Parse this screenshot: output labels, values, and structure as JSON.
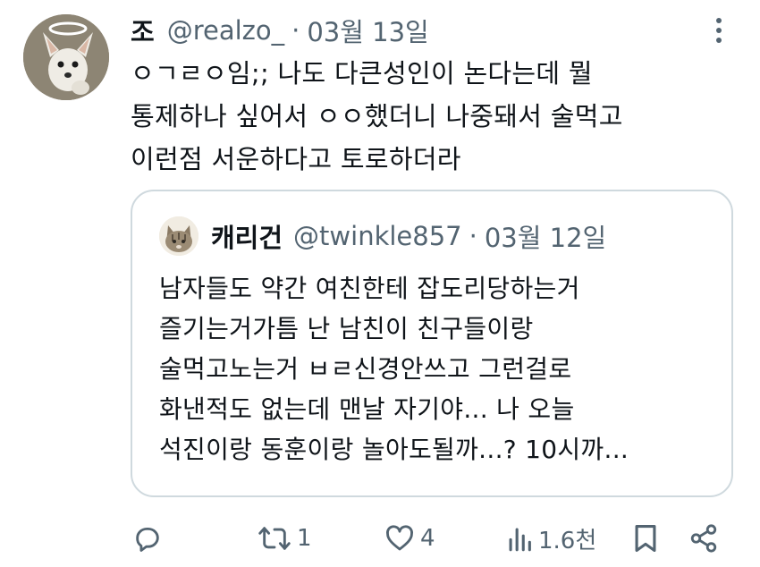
{
  "tweet": {
    "author_name": "조",
    "handle": "@realzo_",
    "separator": "·",
    "date": "03월 13일",
    "text": "ㅇㄱㄹㅇ임;; 나도 다큰성인이 논다는데 뭘\n통제하나 싶어서 ㅇㅇ했더니 나중돼서 술먹고\n이런점 서운하다고 토로하더라"
  },
  "quoted": {
    "author_name": "캐리건",
    "handle": "@twinkle857",
    "separator": "·",
    "date": "03월 12일",
    "text": "남자들도 약간 여친한테 잡도리당하는거\n즐기는거가틈 난 남친이 친구들이랑\n술먹고노는거 ㅂㄹ신경안쓰고 그런걸로\n화낸적도 없는데 맨날 자기야... 나 오늘\n석진이랑 동훈이랑 놀아도될까...? 10시까..."
  },
  "actions": {
    "retweet_count": "1",
    "like_count": "4",
    "views_count": "1.6천"
  },
  "icons": {
    "avatar": "chihuahua-angel-avatar",
    "quoted_avatar": "cat-avatar",
    "more": "more-vertical-icon",
    "reply": "reply-icon",
    "retweet": "retweet-icon",
    "like": "heart-icon",
    "views": "views-icon",
    "bookmark": "bookmark-icon",
    "share": "share-icon"
  },
  "colors": {
    "text": "#0f1419",
    "secondary": "#536471",
    "border": "#cfd9de"
  }
}
